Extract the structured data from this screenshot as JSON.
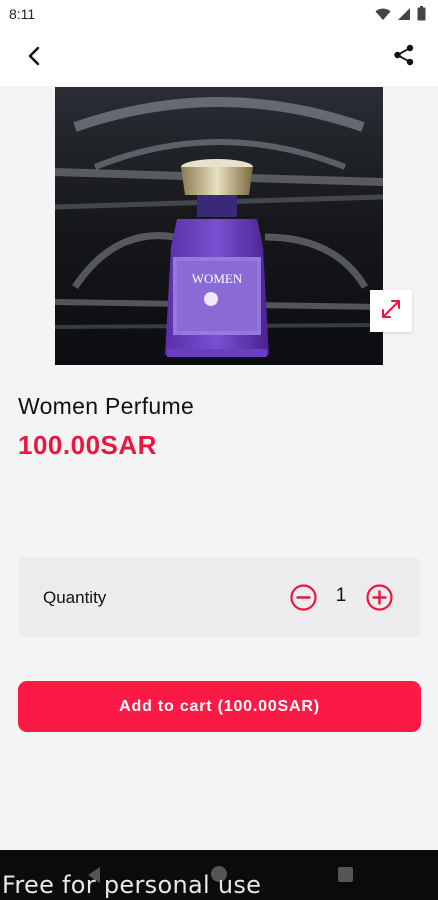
{
  "status_bar": {
    "time": "8:11",
    "icons": [
      "wifi-icon",
      "signal-icon",
      "battery-icon"
    ]
  },
  "app_bar": {
    "back_icon": "back-arrow-icon",
    "share_icon": "share-icon"
  },
  "product": {
    "image_icon": "perfume-bottle-image",
    "bottle_label": "WOMEN",
    "title": "Women Perfume",
    "price": "100.00SAR",
    "expand_icon": "expand-icon"
  },
  "quantity": {
    "label": "Quantity",
    "value": "1",
    "minus_icon": "minus-circle-icon",
    "plus_icon": "plus-circle-icon"
  },
  "cart": {
    "button_label": "Add to cart (100.00SAR)"
  },
  "watermark": "Free for personal use",
  "colors": {
    "accent": "#fb1a45",
    "price": "#e8173f",
    "background": "#f4f4f5",
    "card": "#ececef"
  }
}
